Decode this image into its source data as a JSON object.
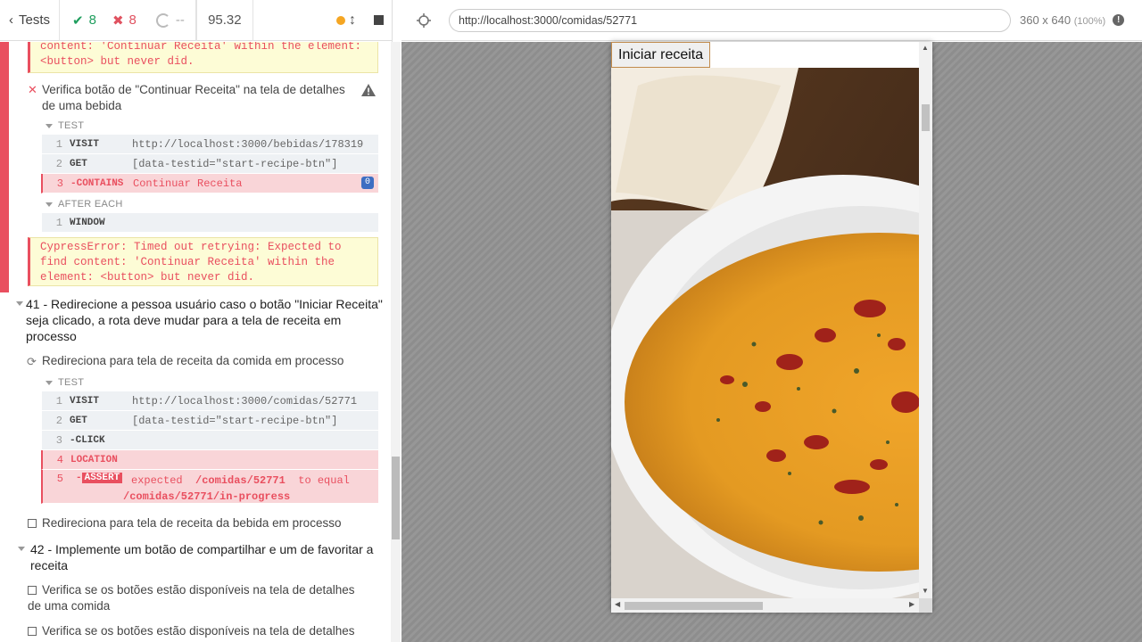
{
  "stats": {
    "tests_label": "Tests",
    "passed": "8",
    "failed": "8",
    "pending": "--",
    "duration": "95.32"
  },
  "errors": {
    "top": "content: 'Continuar Receita' within the element: <button> but never did.",
    "second": "CypressError: Timed out retrying: Expected to find content: 'Continuar Receita' within the element: <button> but never did."
  },
  "test_continuar": {
    "title": "Verifica botão de \"Continuar Receita\" na tela de detalhes de uma bebida",
    "section_test": "TEST",
    "section_after": "AFTER EACH",
    "commands": [
      {
        "num": "1",
        "name": "VISIT",
        "msg": "http://localhost:3000/bebidas/178319"
      },
      {
        "num": "2",
        "name": "GET",
        "msg": "[data-testid=\"start-recipe-btn\"]"
      },
      {
        "num": "3",
        "name": "-CONTAINS",
        "msg": "Continuar Receita",
        "badge": "0"
      }
    ],
    "after_commands": [
      {
        "num": "1",
        "name": "WINDOW"
      }
    ]
  },
  "suite41": {
    "title": "41 - Redirecione a pessoa usuário caso o botão \"Iniciar Receita\" seja clicado, a rota deve mudar para a tela de receita em processo",
    "test_running": "Redireciona para tela de receita da comida em processo",
    "section_test": "TEST",
    "commands": [
      {
        "num": "1",
        "name": "VISIT",
        "msg": "http://localhost:3000/comidas/52771"
      },
      {
        "num": "2",
        "name": "GET",
        "msg": "[data-testid=\"start-recipe-btn\"]"
      },
      {
        "num": "3",
        "name": "-CLICK",
        "msg": ""
      },
      {
        "num": "4",
        "name": "LOCATION",
        "msg": ""
      },
      {
        "num": "5",
        "name": "-",
        "tag": "ASSERT",
        "msg_a": "expected",
        "msg_b": "/comidas/52771",
        "msg_c": "to equal",
        "msg_d": "/comidas/52771/in-progress"
      }
    ],
    "test_pending": "Redireciona para tela de receita da bebida em processo"
  },
  "suite42": {
    "title": "42 - Implemente um botão de compartilhar e um de favoritar a receita",
    "tests": [
      "Verifica se os botões estão disponíveis na tela de detalhes de uma comida",
      "Verifica se os botões estão disponíveis na tela de detalhes"
    ]
  },
  "aut": {
    "url": "http://localhost:3000/comidas/52771",
    "viewport": "360 x 640",
    "scale": "(100%)",
    "start_button": "Iniciar receita"
  },
  "colors": {
    "pass": "#1f9e5e",
    "fail": "#e94f5f",
    "pending_dot": "#f5a623",
    "badge": "#3e6ec2"
  }
}
